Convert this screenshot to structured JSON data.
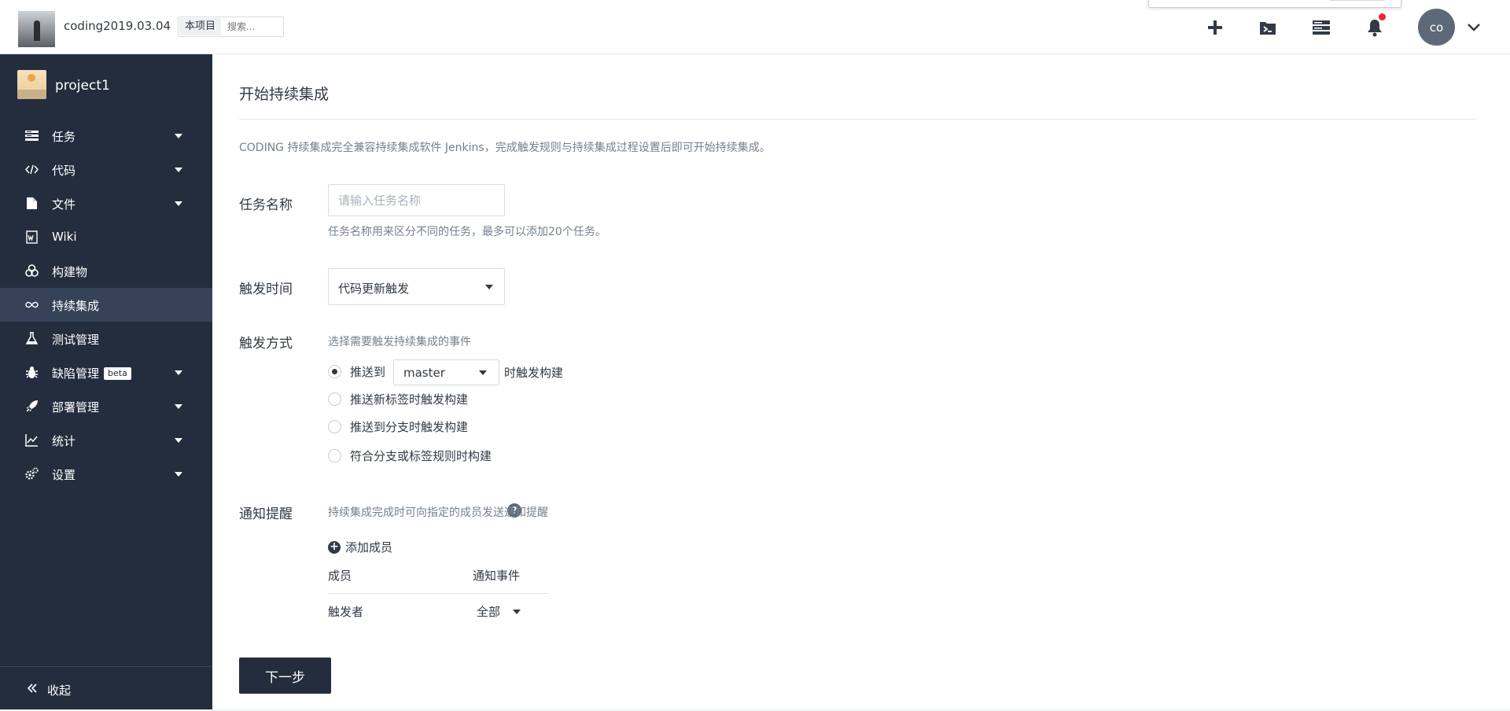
{
  "header": {
    "team_name": "coding2019.03.04",
    "scope_tag": "本项目",
    "search_placeholder": "搜索...",
    "user_initials": "co",
    "icons": [
      "plus-icon",
      "terminal-folder-icon",
      "server-stack-icon",
      "bell-icon",
      "chevron-down-icon"
    ],
    "notification_dot_color": "#f5222d"
  },
  "sidebar": {
    "project_name": "project1",
    "items": [
      {
        "label": "任务",
        "icon": "tasks-icon",
        "has_caret": true
      },
      {
        "label": "代码",
        "icon": "code-icon",
        "has_caret": true
      },
      {
        "label": "文件",
        "icon": "file-icon",
        "has_caret": true
      },
      {
        "label": "Wiki",
        "icon": "wiki-icon",
        "has_caret": false
      },
      {
        "label": "构建物",
        "icon": "artifacts-icon",
        "has_caret": false
      },
      {
        "label": "持续集成",
        "icon": "infinity-icon",
        "has_caret": false,
        "active": true
      },
      {
        "label": "测试管理",
        "icon": "flask-icon",
        "has_caret": false
      },
      {
        "label": "缺陷管理",
        "icon": "bug-icon",
        "has_caret": true,
        "badge": "beta"
      },
      {
        "label": "部署管理",
        "icon": "rocket-icon",
        "has_caret": true
      },
      {
        "label": "统计",
        "icon": "chart-icon",
        "has_caret": true
      },
      {
        "label": "设置",
        "icon": "gears-icon",
        "has_caret": true
      }
    ],
    "collapse_label": "收起",
    "bg_color": "#232d3e",
    "active_color": "#364257"
  },
  "main": {
    "title": "开始持续集成",
    "description": "CODING 持续集成完全兼容持续集成软件 Jenkins，完成触发规则与持续集成过程设置后即可开始持续集成。",
    "task_name": {
      "label": "任务名称",
      "placeholder": "请输入任务名称",
      "value": "",
      "help": "任务名称用来区分不同的任务，最多可以添加20个任务。"
    },
    "trigger_time": {
      "label": "触发时间",
      "selected": "代码更新触发"
    },
    "trigger_mode": {
      "label": "触发方式",
      "description": "选择需要触发持续集成的事件",
      "push_to_label": "推送到",
      "branch": "master",
      "push_to_suffix": "时触发构建",
      "options": [
        {
          "label": "推送新标签时触发构建",
          "checked": false
        },
        {
          "label": "推送到分支时触发构建",
          "checked": false
        },
        {
          "label": "符合分支或标签规则时构建",
          "checked": false
        }
      ],
      "first_checked": true
    },
    "notify": {
      "label": "通知提醒",
      "description": "持续集成完成时可向指定的成员发送通知提醒",
      "add_member": "添加成员",
      "columns": [
        "成员",
        "通知事件"
      ],
      "rows": [
        {
          "member": "触发者",
          "event": "全部"
        }
      ]
    },
    "next_button": "下一步"
  }
}
